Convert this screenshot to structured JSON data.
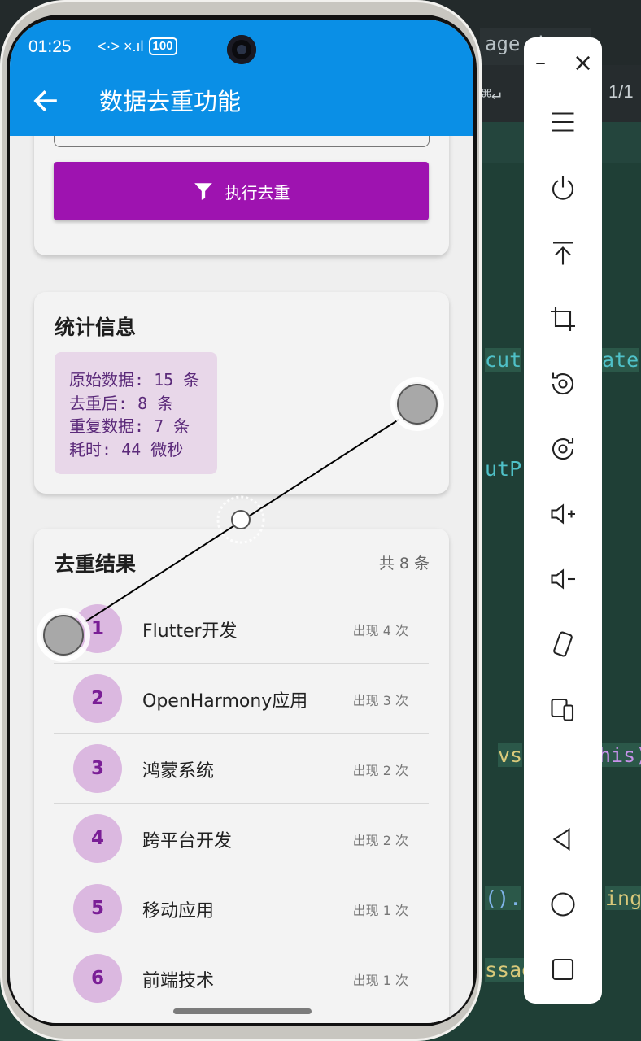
{
  "background_editor": {
    "tab_title": "age.d",
    "search_shortcut": "⌘↵",
    "match_count": "1/1",
    "code_fragments": [
      "cut",
      "ate",
      "utP",
      "vs",
      "his)",
      "().",
      "ing",
      "ssag"
    ]
  },
  "status_bar": {
    "time": "01:25",
    "signal": "<·> ×.ıl",
    "battery": "100"
  },
  "app_bar": {
    "title": "数据去重功能",
    "back_icon": "arrow-left-icon",
    "color": "#0a8fe6"
  },
  "dedupe_card": {
    "button_label": "执行去重",
    "button_icon": "filter-icon",
    "button_color": "#9e13b0"
  },
  "stats_card": {
    "title": "统计信息",
    "lines": [
      "原始数据: 15 条",
      "去重后: 8 条",
      "重复数据: 7 条",
      "耗时: 44 微秒"
    ]
  },
  "results_card": {
    "title": "去重结果",
    "total": "共 8 条",
    "items": [
      {
        "index": "1",
        "label": "Flutter开发",
        "count": "出现 4 次"
      },
      {
        "index": "2",
        "label": "OpenHarmony应用",
        "count": "出现 3 次"
      },
      {
        "index": "3",
        "label": "鸿蒙系统",
        "count": "出现 2 次"
      },
      {
        "index": "4",
        "label": "跨平台开发",
        "count": "出现 2 次"
      },
      {
        "index": "5",
        "label": "移动应用",
        "count": "出现 1 次"
      },
      {
        "index": "6",
        "label": "前端技术",
        "count": "出现 1 次"
      }
    ]
  },
  "emulator_toolbar": {
    "minimize_label": "–",
    "close_label": "×",
    "icons": [
      "menu-icon",
      "power-icon",
      "pin-top-icon",
      "crop-icon",
      "rotate-left-icon",
      "rotate-right-icon",
      "volume-up-icon",
      "volume-down-icon",
      "shake-icon",
      "device-switch-icon",
      "back-triangle-icon",
      "home-circle-icon",
      "recents-square-icon"
    ]
  }
}
